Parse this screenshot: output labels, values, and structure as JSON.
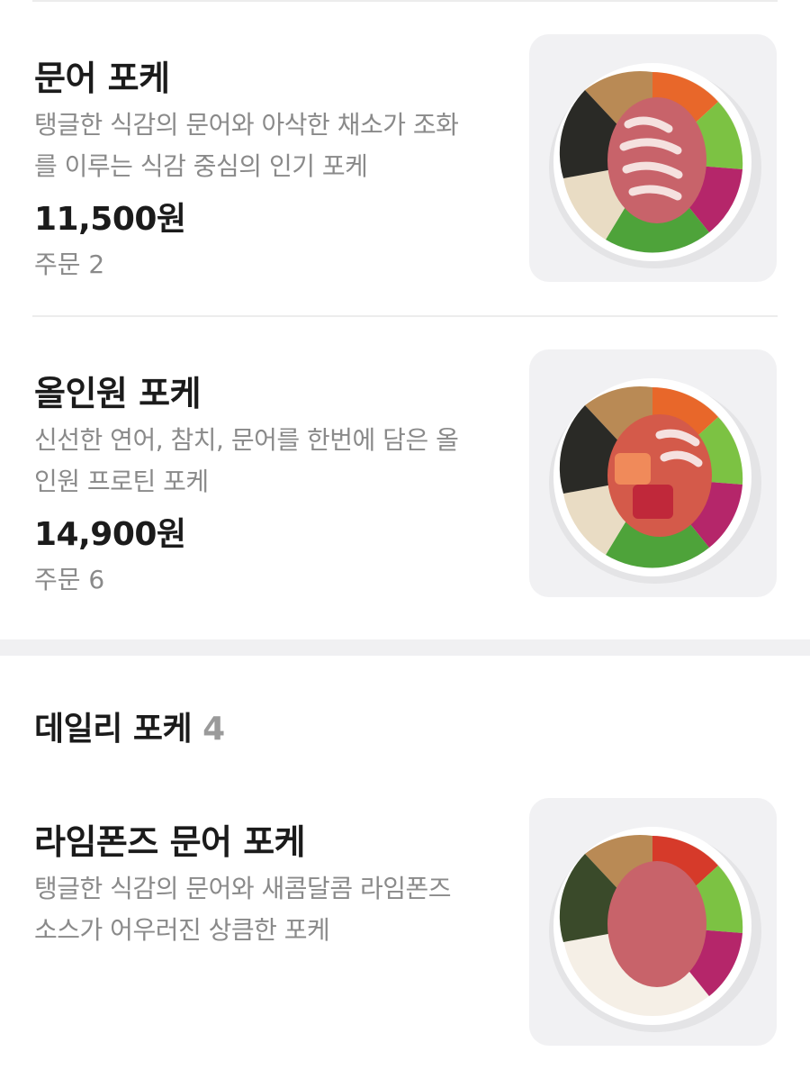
{
  "menu_items": [
    {
      "name": "문어 포케",
      "description_line1": "탱글한 식감의 문어와 아삭한 채소가 조화",
      "description_line2": "를 이루는 식감 중심의 인기 포케",
      "price": "11,500원",
      "orders": "주문 2",
      "image_icon": "octopus-poke-bowl"
    },
    {
      "name": "올인원 포케",
      "description_line1": "신선한 연어, 참치, 문어를 한번에 담은 올",
      "description_line2": "인원 프로틴 포케",
      "price": "14,900원",
      "orders": "주문 6",
      "image_icon": "allinone-poke-bowl"
    },
    {
      "name": "라임폰즈 문어 포케",
      "description_line1": "탱글한 식감의 문어와 새콤달콤 라임폰즈",
      "description_line2": "소스가 어우러진 상큼한 포케",
      "image_icon": "lime-ponzu-poke-bowl"
    }
  ],
  "section": {
    "title": "데일리 포케",
    "count": "4"
  },
  "colors": {
    "text_primary": "#1b1b1b",
    "text_secondary": "#8a8a8a",
    "divider": "#ececec",
    "thumb_bg": "#f1f1f3"
  }
}
